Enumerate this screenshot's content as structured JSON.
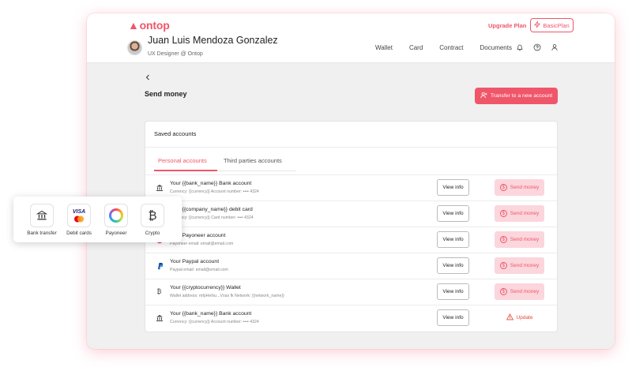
{
  "brand": {
    "logo_text": "ontop",
    "accent": "#f0566a"
  },
  "topbar": {
    "upgrade_label": "Upgrade Plan",
    "plan_label": "BasicPlan",
    "user_name": "Juan Luis Mendoza Gonzalez",
    "user_role": "UX Designer @ Ontop",
    "nav": [
      "Wallet",
      "Card",
      "Contract",
      "Documents"
    ],
    "nav_icons": [
      "bell-icon",
      "help-icon",
      "user-icon"
    ]
  },
  "page": {
    "back_icon": "chevron-left-icon",
    "title": "Send money",
    "transfer_label": "Transfer to a new account"
  },
  "saved": {
    "title": "Saved accounts",
    "tabs": [
      "Personal accounts",
      "Third parties accounts"
    ],
    "active_tab": "Personal accounts",
    "rows": [
      {
        "icon": "bank-icon",
        "title": "Your {{bank_name}} Bank account",
        "sub": "Currency: {{currency}}   Account number: •••• 4324",
        "view": "View info",
        "action": "Send money",
        "action_type": "send"
      },
      {
        "icon": "card-icon",
        "title": "Your {{company_name}} debit card",
        "sub": "Currency: {{currency}}   Card number: •••• 4324",
        "view": "View info",
        "action": "Send money",
        "action_type": "send"
      },
      {
        "icon": "payoneer-icon",
        "title": "Your Payoneer account",
        "sub": "Payoneer email: email@email.com",
        "view": "View info",
        "action": "Send money",
        "action_type": "send"
      },
      {
        "icon": "paypal-icon",
        "title": "Your Paypal account",
        "sub": "Paypal email: email@email.com",
        "view": "View info",
        "action": "Send money",
        "action_type": "send"
      },
      {
        "icon": "bitcoin-icon",
        "title": "Your {{cryptocurrency}} Wallet",
        "sub": "Wallet address: mfpHefsu...Vxas fk   Network: {{network_name}}",
        "view": "View info",
        "action": "Send money",
        "action_type": "send"
      },
      {
        "icon": "bank-icon",
        "title": "Your {{bank_name}} Bank account",
        "sub": "Currency: {{currency}}   Account number: •••• 4324",
        "view": "View info",
        "action": "Update",
        "action_type": "update"
      }
    ]
  },
  "methods": {
    "items": [
      {
        "label": "Bank transfer",
        "icon": "bank-icon"
      },
      {
        "label": "Debit cards",
        "icon": "visa-mastercard-icon",
        "brand_text": "VISA"
      },
      {
        "label": "Payoneer",
        "icon": "payoneer-ring-icon"
      },
      {
        "label": "Crypto",
        "icon": "bitcoin-icon"
      }
    ]
  }
}
